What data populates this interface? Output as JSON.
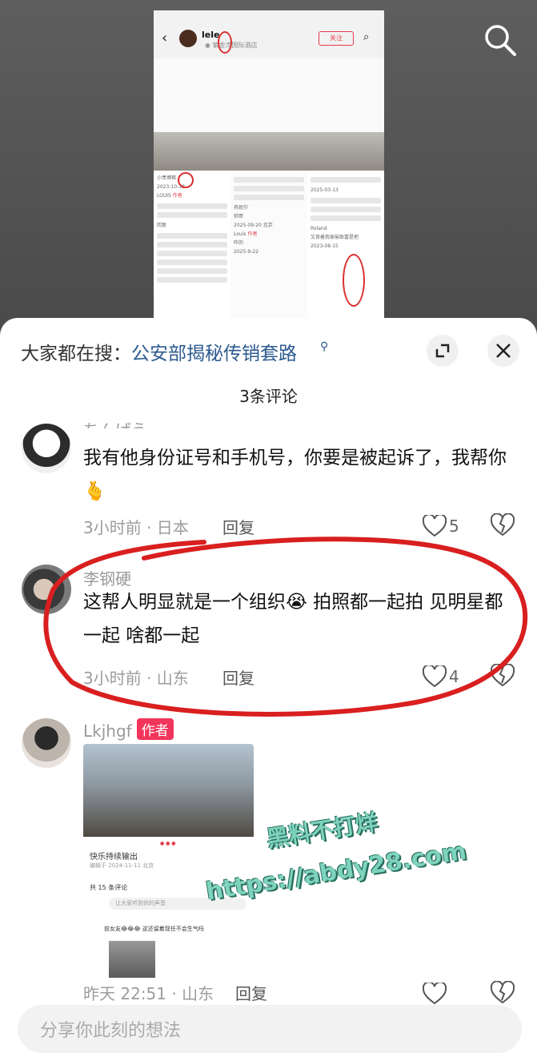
{
  "video": {
    "username": "lele",
    "location": "紫金湾国际酒店",
    "follow_label": "关注",
    "thumb_dates": [
      "2023-10-18",
      "2025-03-13",
      "2025-09-20",
      "2023-08-15",
      "2025-9-22"
    ],
    "thumb_names": [
      "LOUIS",
      "Louis",
      "Roland",
      "冉屁尔"
    ],
    "thumb_texts": [
      "小羡博梯",
      "帅哥",
      "咋的",
      "又背着我偷偷致富是把",
      "回复"
    ],
    "author_tag": "作者",
    "location_tags": [
      "北京"
    ]
  },
  "sheet": {
    "hot_search_prefix": "大家都在搜：",
    "hot_search_link": "公安部揭秘传销套路",
    "title": "3条评论"
  },
  "comments": [
    {
      "username": "ちんげう",
      "text": "我有他身份证号和手机号，你要是被起诉了，我帮你🫰",
      "meta": "3小时前 · 日本",
      "reply": "回复",
      "likes": "5"
    },
    {
      "username": "李钢硬",
      "text": "这帮人明显就是一个组织😭 拍照都一起拍 见明星都一起 啥都一起",
      "meta": "3小时前 · 山东",
      "reply": "回复",
      "likes": "4"
    },
    {
      "username": "Lkjhgf",
      "author_tag": "作者",
      "meta": "昨天 22:51 · 山东",
      "reply": "回复",
      "card": {
        "title": "快乐持续输出",
        "date": "编辑于 2024-11-11 北京",
        "count": "共 15 条评论",
        "input_placeholder": "让大家听到你的声音",
        "comment": "前女友😂😂😂 这还留着现任不会生气吗"
      }
    }
  ],
  "watermark": {
    "line1": "黑料不打烊",
    "line2": "https://abdy28.com"
  },
  "input": {
    "placeholder": "分享你此刻的想法"
  },
  "colors": {
    "author_tag": "#f2355a",
    "link": "#2c5a8f",
    "annotation": "#d91f1f",
    "watermark": "#7ed3bd"
  },
  "icons": [
    "search-icon",
    "expand-icon",
    "close-icon",
    "heart-icon",
    "broken-heart-icon",
    "back-icon",
    "location-icon"
  ]
}
